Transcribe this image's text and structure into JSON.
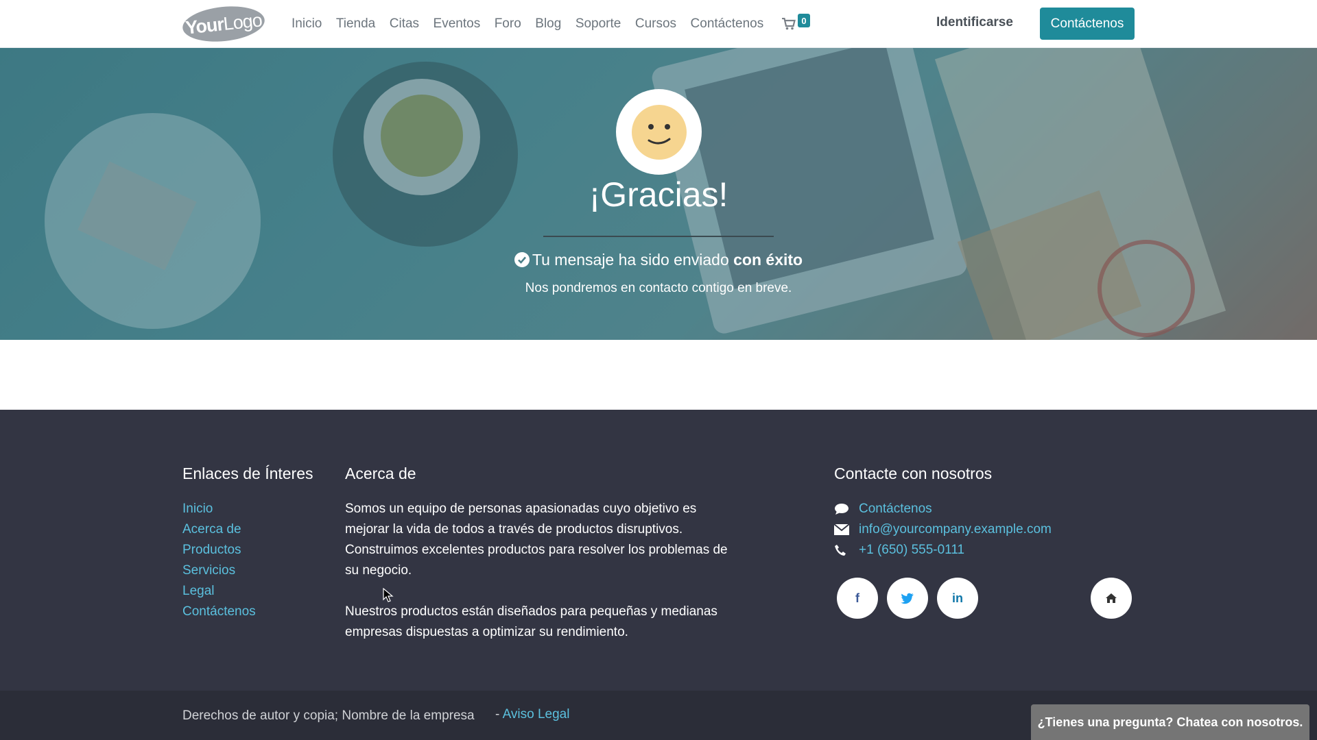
{
  "header": {
    "logo": {
      "part1": "Your",
      "part2": "Logo"
    },
    "nav": [
      "Inicio",
      "Tienda",
      "Citas",
      "Eventos",
      "Foro",
      "Blog",
      "Soporte",
      "Cursos",
      "Contáctenos"
    ],
    "cart_count": "0",
    "login_label": "Identificarse",
    "cta_label": "Contáctenos"
  },
  "hero": {
    "title": "¡Gracias!",
    "success_text": "Tu mensaje ha sido enviado ",
    "success_bold": "con éxito",
    "subtext": "Nos pondremos en contacto contigo en breve."
  },
  "footer": {
    "links_title": "Enlaces de Ínteres",
    "links": [
      "Inicio",
      "Acerca de",
      "Productos",
      "Servicios",
      "Legal",
      "Contáctenos"
    ],
    "about_title": "Acerca de",
    "about_p1": "Somos un equipo de personas apasionadas cuyo objetivo es mejorar la vida de todos a través de productos disruptivos. Construimos excelentes productos para resolver los problemas de su negocio.",
    "about_p2": "Nuestros productos están diseñados para pequeñas y medianas empresas dispuestas a optimizar su rendimiento.",
    "contact_title": "Contacte con nosotros",
    "contact_link": "Contáctenos",
    "email": "info@yourcompany.example.com",
    "phone": "+1 (650) 555-0111",
    "social": {
      "facebook": "f",
      "linkedin": "in"
    }
  },
  "bottom": {
    "copyright": "Derechos de autor y copia; Nombre de la empresa",
    "legal_dash": "- ",
    "legal_link": "Aviso Legal"
  },
  "chat_label": "¿Tienes una pregunta? Chatea con nosotros.",
  "colors": {
    "accent": "#1f8b9a",
    "link": "#5bc0de",
    "footer_bg": "#333543",
    "bottom_bg": "#2b2d38"
  }
}
